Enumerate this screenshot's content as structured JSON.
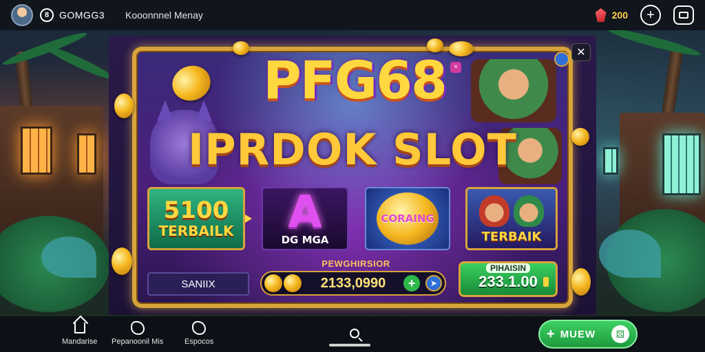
{
  "topbar": {
    "brand": "GOMGG3",
    "tagline": "Kooonnnel Menay",
    "balance": "200",
    "icons": [
      "avatar",
      "coin-icon",
      "gem-icon",
      "plus-icon",
      "wallet-icon"
    ]
  },
  "game": {
    "title_line1": "PFG68",
    "title_line2": "IPRDOK SLOT",
    "close_symbol": "✕"
  },
  "tiles": [
    {
      "big": "5100",
      "small": "TERBAILK"
    },
    {
      "glyph": "A",
      "label": "DG MGA"
    },
    {
      "label": "CORAING"
    },
    {
      "label": "TERBAIK"
    }
  ],
  "controls": {
    "mode": "SANIIX",
    "bet_label": "PEWGHIRSIOR",
    "bet_value": "2133,0990",
    "win_label": "PIHAISIN",
    "win_value": "233.1.00"
  },
  "bottom_nav": {
    "items": [
      {
        "label": "Mandarise",
        "icon": "home-icon"
      },
      {
        "label": "Pepanoonil Mis",
        "icon": "badge-icon"
      },
      {
        "label": "Espocos",
        "icon": "tag-icon"
      }
    ],
    "cta_label": "MUEW",
    "cta_plus": "+"
  },
  "colors": {
    "accent_gold": "#d9a43a",
    "cta_green": "#2fb84a",
    "title_yellow": "#ffd840"
  }
}
